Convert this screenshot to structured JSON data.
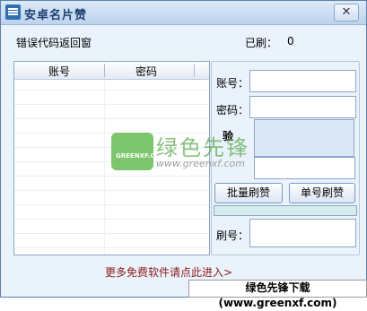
{
  "window": {
    "title": "安卓名片赞",
    "close_glyph": "✕"
  },
  "status": {
    "error_label": "错误代码返回窗",
    "count_label": "已刷：",
    "count_value": "0"
  },
  "table": {
    "columns": [
      "账号",
      "密码"
    ]
  },
  "form": {
    "account_label": "账号：",
    "password_label": "密码：",
    "verify_label": "验",
    "batch_button": "批量刷赞",
    "single_button": "单号刷赞",
    "refresh_label": "刷号："
  },
  "footer": {
    "link": "更多免费软件请点此进入>"
  },
  "watermark": {
    "logo_text": "GREENXF.COM",
    "cn": "绿色先锋",
    "url": "www.greenxf.com"
  },
  "banner": {
    "text": "绿色先锋下载(www.greenxf.com)"
  }
}
